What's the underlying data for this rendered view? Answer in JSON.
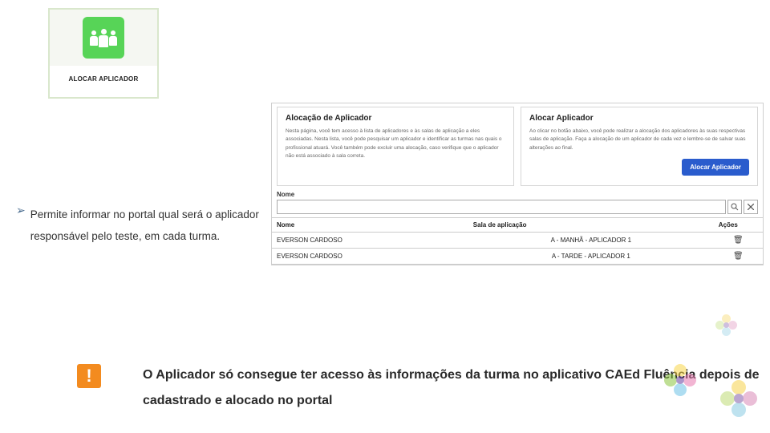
{
  "card": {
    "label": "ALOCAR APLICADOR",
    "icon_name": "people-group-icon"
  },
  "bullet": {
    "text": "Permite informar no portal qual será o aplicador responsável pelo teste, em cada turma."
  },
  "panel": {
    "left_title": "Alocação de Aplicador",
    "left_text": "Nesta página, você tem acesso à lista de aplicadores e às salas de aplicação a eles associadas. Nesta lista, você pode pesquisar um aplicador e identificar as turmas nas quais o profissional atuará. Você também pode excluir uma alocação, caso verifique que o aplicador não está associado à sala correta.",
    "right_title": "Alocar Aplicador",
    "right_text": "Ao clicar no botão abaixo, você pode realizar a alocação dos aplicadores às suas respectivas salas de aplicação. Faça a alocação de um aplicador de cada vez e lembre-se de salvar suas alterações ao final.",
    "button": "Alocar Aplicador"
  },
  "filter": {
    "label": "Nome",
    "search_icon": "search-icon",
    "clear_icon": "clear-icon"
  },
  "table": {
    "headers": {
      "name": "Nome",
      "room": "Sala de aplicação",
      "actions": "Ações"
    },
    "rows": [
      {
        "name": "EVERSON CARDOSO",
        "room": "A - MANHÃ - APLICADOR 1"
      },
      {
        "name": "EVERSON CARDOSO",
        "room": "A - TARDE - APLICADOR 1"
      }
    ]
  },
  "warning": {
    "badge": "!",
    "text": "O Aplicador só consegue ter acesso às informações da turma no aplicativo CAEd Fluência depois de cadastrado e alocado no portal"
  }
}
